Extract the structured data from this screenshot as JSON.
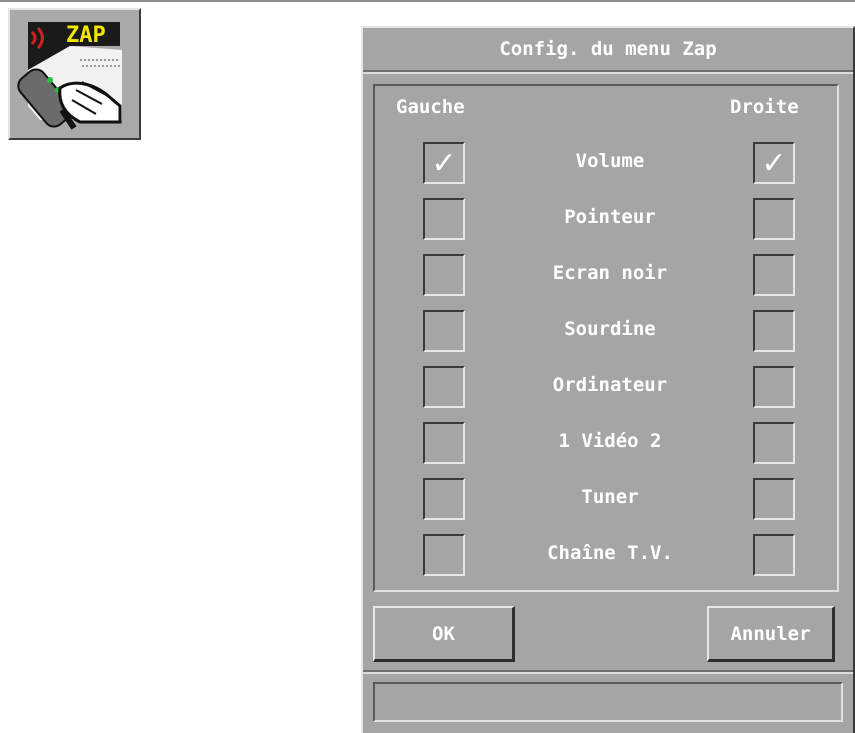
{
  "desktop_icon": {
    "label": "ZAP",
    "icon": "remote-control-hand-icon",
    "label_color": "#f5e600"
  },
  "dialog": {
    "title": "Config. du menu Zap",
    "left_header": "Gauche",
    "right_header": "Droite",
    "rows": [
      {
        "label": "Volume",
        "left_checked": true,
        "right_checked": true
      },
      {
        "label": "Pointeur",
        "left_checked": false,
        "right_checked": false
      },
      {
        "label": "Ecran noir",
        "left_checked": false,
        "right_checked": false
      },
      {
        "label": "Sourdine",
        "left_checked": false,
        "right_checked": false
      },
      {
        "label": "Ordinateur",
        "left_checked": false,
        "right_checked": false
      },
      {
        "label": "1 Vidéo 2",
        "left_checked": false,
        "right_checked": false
      },
      {
        "label": "Tuner",
        "left_checked": false,
        "right_checked": false
      },
      {
        "label": "Chaîne T.V.",
        "left_checked": false,
        "right_checked": false
      }
    ],
    "ok_label": "OK",
    "cancel_label": "Annuler",
    "status_text": "",
    "check_mark": "✓"
  },
  "colors": {
    "face": "#a5a5a5",
    "text": "#ffffff"
  }
}
